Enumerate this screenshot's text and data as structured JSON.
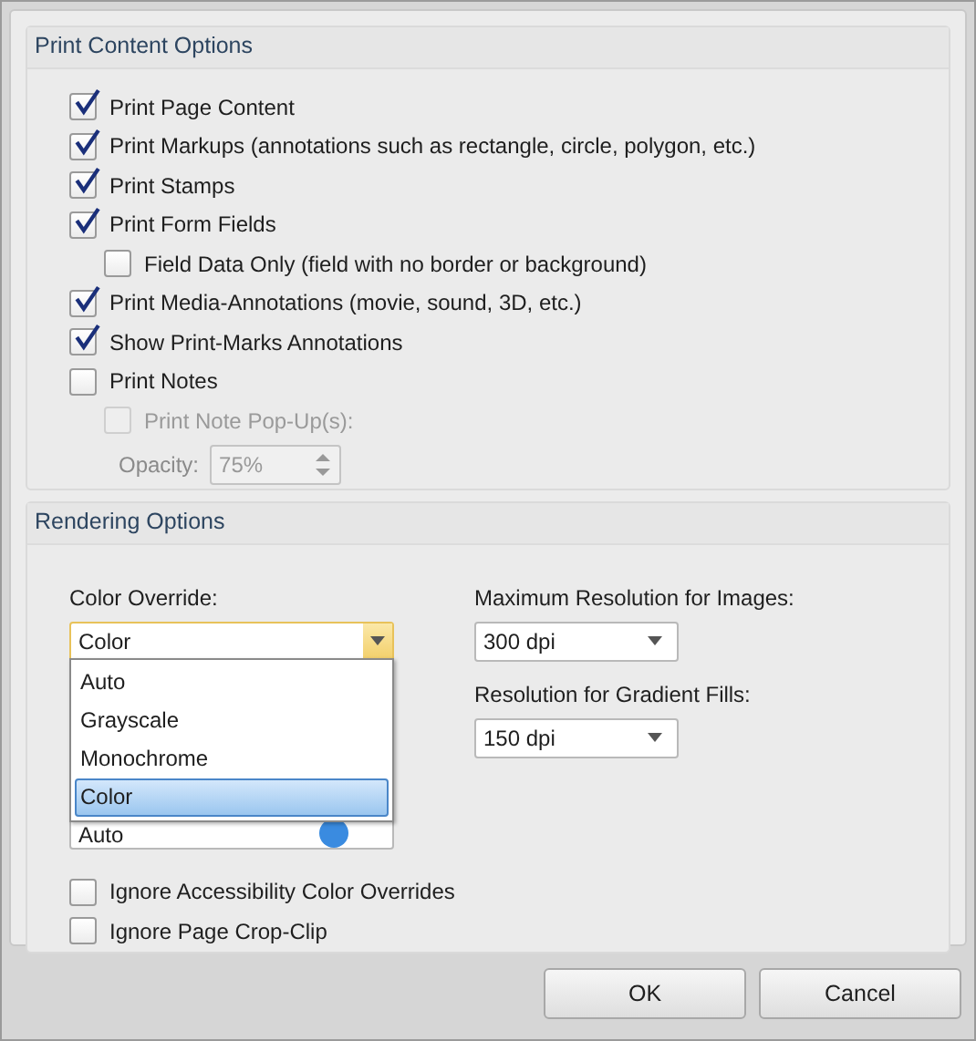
{
  "print_content_options": {
    "title": "Print Content Options",
    "options": [
      {
        "label": "Print Page Content",
        "checked": true,
        "disabled": false
      },
      {
        "label": "Print Markups (annotations such as rectangle, circle, polygon, etc.)",
        "checked": true,
        "disabled": false
      },
      {
        "label": "Print Stamps",
        "checked": true,
        "disabled": false
      },
      {
        "label": "Print Form Fields",
        "checked": true,
        "disabled": false,
        "children": [
          {
            "label": "Field Data Only (field with no border or background)",
            "checked": false,
            "disabled": false
          }
        ]
      },
      {
        "label": "Print Media-Annotations (movie, sound, 3D, etc.)",
        "checked": true,
        "disabled": false
      },
      {
        "label": "Show Print-Marks Annotations",
        "checked": true,
        "disabled": false
      },
      {
        "label": "Print Notes",
        "checked": false,
        "disabled": false,
        "children": [
          {
            "label": "Print Note Pop-Up(s):",
            "checked": false,
            "disabled": true
          }
        ]
      }
    ],
    "opacity": {
      "label": "Opacity:",
      "value": "75%",
      "disabled": true
    }
  },
  "rendering_options": {
    "title": "Rendering Options",
    "color_override": {
      "label": "Color Override:",
      "value": "Color",
      "expanded": true,
      "options": [
        {
          "label": "Auto",
          "selected": false
        },
        {
          "label": "Grayscale",
          "selected": false
        },
        {
          "label": "Monochrome",
          "selected": false
        },
        {
          "label": "Color",
          "selected": true
        }
      ]
    },
    "covered_combo": {
      "value": "Auto"
    },
    "max_resolution_images": {
      "label": "Maximum Resolution for Images:",
      "value": "300 dpi"
    },
    "resolution_gradient_fills": {
      "label": "Resolution for Gradient Fills:",
      "value": "150 dpi"
    },
    "options": [
      {
        "label": "Ignore Accessibility Color Overrides",
        "checked": false
      },
      {
        "label": "Ignore Page Crop-Clip",
        "checked": false
      }
    ]
  },
  "buttons": [
    "OK",
    "Cancel"
  ]
}
